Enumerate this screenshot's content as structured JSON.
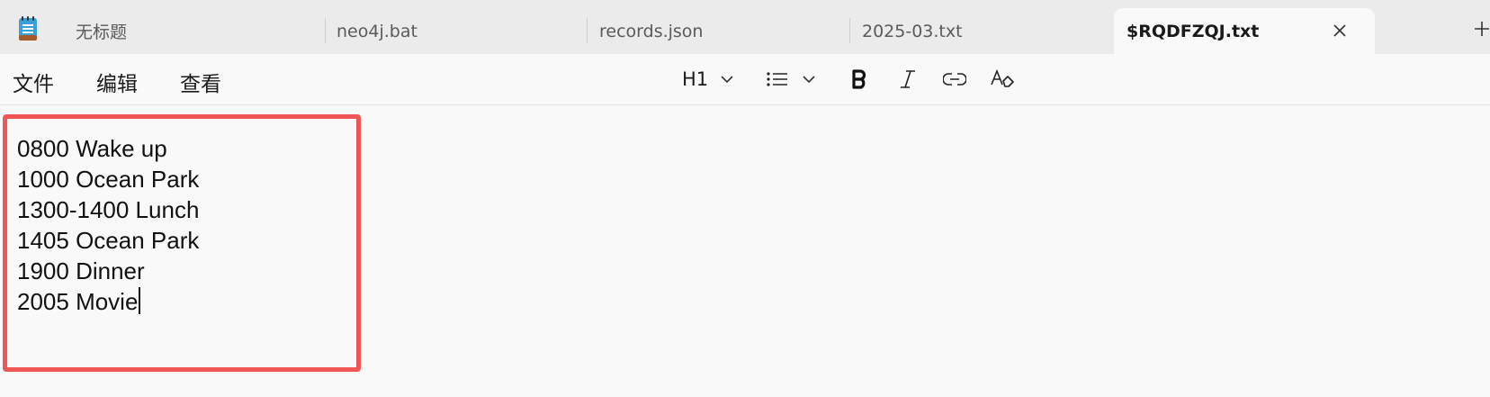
{
  "tabs": [
    {
      "label": "无标题",
      "active": false
    },
    {
      "label": "neo4j.bat",
      "active": false
    },
    {
      "label": "records.json",
      "active": false
    },
    {
      "label": "2025-03.txt",
      "active": false
    },
    {
      "label": "$RQDFZQJ.txt",
      "active": true
    }
  ],
  "menu": {
    "file": "文件",
    "edit": "编辑",
    "view": "查看"
  },
  "toolbar": {
    "heading": "H1",
    "icons": [
      "chevron-down-icon",
      "list-icon",
      "bold-icon",
      "italic-icon",
      "link-icon",
      "clear-formatting-icon"
    ]
  },
  "editor": {
    "lines": [
      "0800 Wake up",
      "1000 Ocean Park",
      "1300-1400 Lunch",
      "1405 Ocean Park",
      "1900 Dinner",
      "2005 Movie"
    ]
  },
  "colors": {
    "highlight_border": "#f05656",
    "tabstrip_bg": "#ebebeb",
    "editor_bg": "#f9f9f9",
    "app_icon_blue": "#3aa0d8"
  }
}
